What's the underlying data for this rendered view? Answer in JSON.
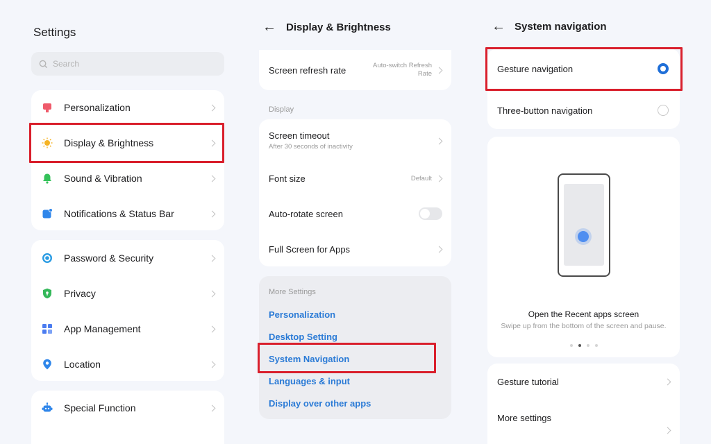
{
  "settings": {
    "title": "Settings",
    "search_placeholder": "Search",
    "group1": [
      "Personalization",
      "Display & Brightness",
      "Sound & Vibration",
      "Notifications & Status Bar"
    ],
    "group2": [
      "Password & Security",
      "Privacy",
      "App Management",
      "Location"
    ],
    "group3": [
      "Special Function"
    ]
  },
  "display": {
    "title": "Display & Brightness",
    "refresh_label": "Screen refresh rate",
    "refresh_value": "Auto-switch Refresh Rate",
    "section_display": "Display",
    "timeout_label": "Screen timeout",
    "timeout_sub": "After 30 seconds of inactivity",
    "font_label": "Font size",
    "font_value": "Default",
    "autorotate_label": "Auto-rotate screen",
    "fullscreen_label": "Full Screen for Apps",
    "section_more": "More Settings",
    "links": [
      "Personalization",
      "Desktop Setting",
      "System Navigation",
      "Languages & input",
      "Display over other apps"
    ]
  },
  "nav": {
    "title": "System navigation",
    "option_gesture": "Gesture navigation",
    "option_three": "Three-button navigation",
    "illus_title": "Open the Recent apps screen",
    "illus_sub": "Swipe up from the bottom of the screen and pause.",
    "tutorial_label": "Gesture tutorial",
    "more_label": "More settings"
  },
  "colors": {
    "accent": "#2b7bd6",
    "highlight": "#d91f2c",
    "background": "#f4f6fb"
  }
}
